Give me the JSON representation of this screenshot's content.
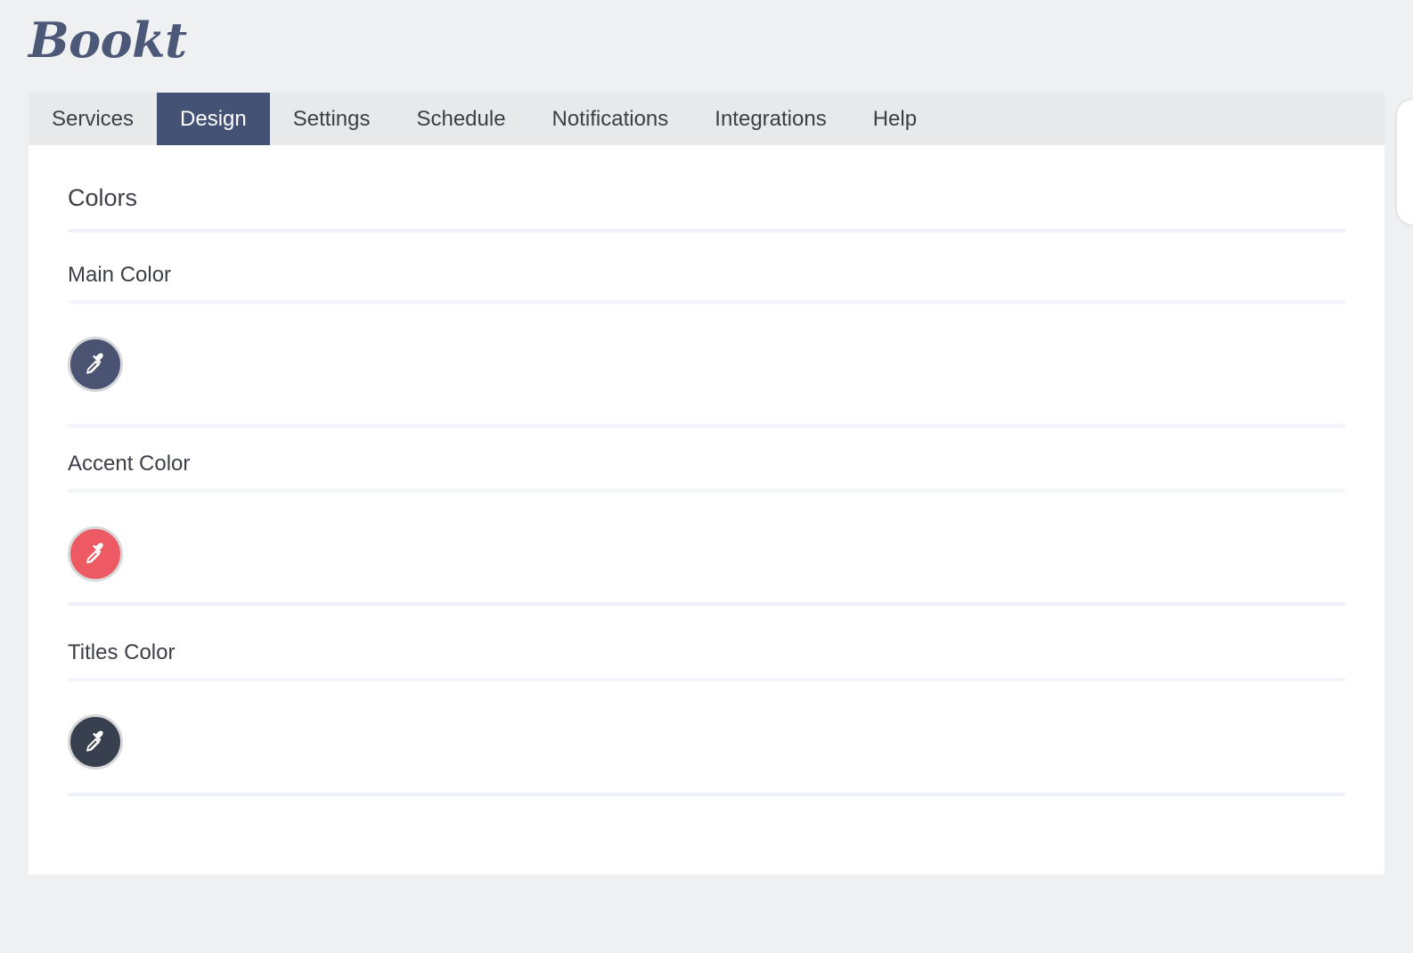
{
  "brand": {
    "name": "Bookt",
    "color": "#4c5878"
  },
  "tabs": [
    {
      "label": "Services",
      "active": false
    },
    {
      "label": "Design",
      "active": true
    },
    {
      "label": "Settings",
      "active": false
    },
    {
      "label": "Schedule",
      "active": false
    },
    {
      "label": "Notifications",
      "active": false
    },
    {
      "label": "Integrations",
      "active": false
    },
    {
      "label": "Help",
      "active": false
    }
  ],
  "active_tab_color": "#445275",
  "page": {
    "section_title": "Colors",
    "fields": [
      {
        "label": "Main Color",
        "swatch_color": "#4a5472",
        "icon": "eyedropper-icon"
      },
      {
        "label": "Accent Color",
        "swatch_color": "#ed5a64",
        "icon": "eyedropper-icon"
      },
      {
        "label": "Titles Color",
        "swatch_color": "#38404f",
        "icon": "eyedropper-icon"
      }
    ]
  }
}
